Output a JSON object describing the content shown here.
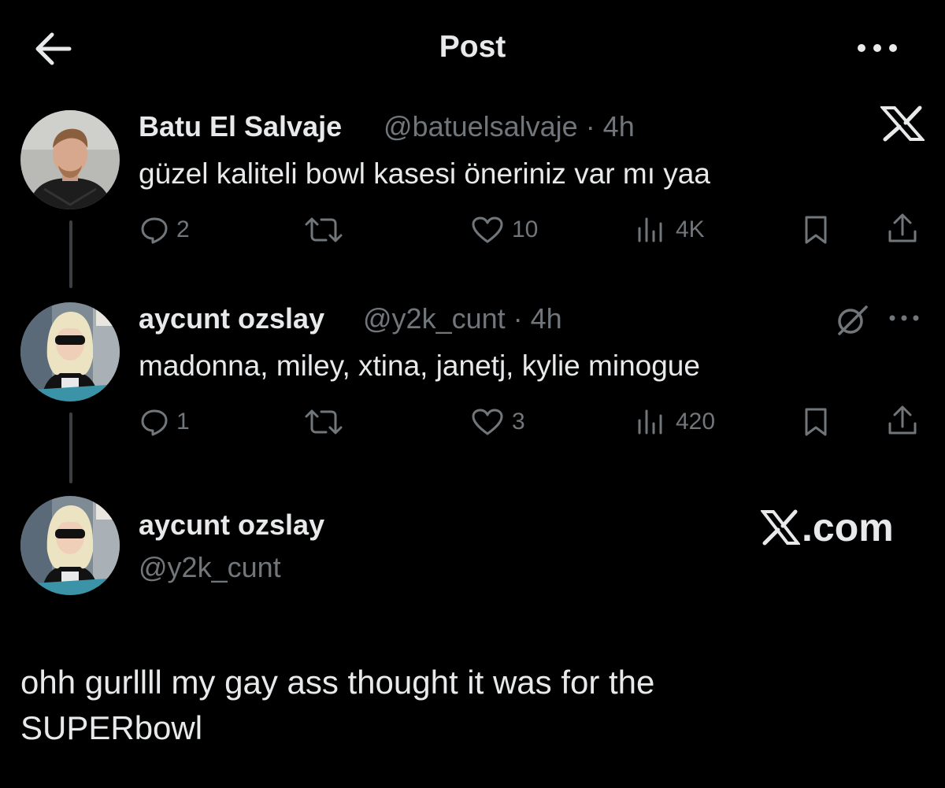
{
  "header": {
    "title": "Post",
    "back_icon": "arrow-left-icon",
    "more_icon": "more-horizontal-icon"
  },
  "posts": [
    {
      "name": "Batu El Salvaje",
      "handle_time": "@batuelsalvaje · 4h",
      "text": "güzel kaliteli bowl kasesi öneriniz var mı yaa",
      "replies": "2",
      "likes": "10",
      "views": "4K"
    },
    {
      "name": "aycunt ozslay",
      "handle_time": "@y2k_cunt · 4h",
      "text": "madonna, miley, xtina, janetj, kylie minogue",
      "replies": "1",
      "likes": "3",
      "views": "420"
    }
  ],
  "reply": {
    "name": "aycunt ozslay",
    "handle": "@y2k_cunt",
    "text_line1": "ohh gurllll my gay ass thought it was for the",
    "text_line2": "SUPERbowl"
  },
  "watermark": ".com",
  "colors": {
    "background": "#000000",
    "text": "#e7e9ea",
    "muted": "#71767b",
    "thread_line": "#3b3f43"
  }
}
